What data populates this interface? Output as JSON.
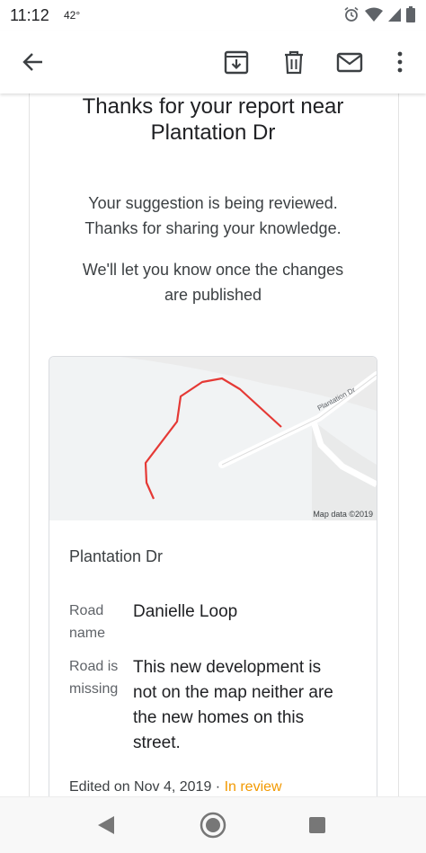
{
  "status_bar": {
    "time": "11:12",
    "temperature": "42°",
    "icons": [
      "alarm-icon",
      "wifi-icon",
      "cellular-signal-icon",
      "battery-icon"
    ]
  },
  "toolbar": {
    "icons": [
      "back-arrow-icon",
      "archive-icon",
      "delete-icon",
      "mark-unread-icon",
      "more-vert-icon"
    ]
  },
  "email": {
    "title_line1": "Thanks for your report near",
    "title_line2": "Plantation Dr",
    "message1_line1": "Your suggestion is being reviewed.",
    "message1_line2": "Thanks for sharing your knowledge.",
    "message2_line1": "We'll let you know once the changes",
    "message2_line2": "are published"
  },
  "report_card": {
    "map_road_label": "Plantation Dr",
    "map_attribution": "Map data ©2019",
    "place_name": "Plantation Dr",
    "fields": [
      {
        "label_line1": "Road",
        "label_line2": "name",
        "value": "Danielle Loop"
      },
      {
        "label_line1": "Road is",
        "label_line2": "missing",
        "value_lines": [
          "This new development is",
          "not on the map neither are",
          "the new homes on this",
          "street."
        ]
      }
    ],
    "edited_text": "Edited on Nov 4, 2019 · ",
    "status": "In review"
  },
  "colors": {
    "route_line": "#e53935",
    "in_review": "#f29900",
    "map_background": "#f1f3f4"
  },
  "nav_bar": {
    "icons": [
      "nav-back-icon",
      "nav-home-icon",
      "nav-recents-icon"
    ]
  }
}
